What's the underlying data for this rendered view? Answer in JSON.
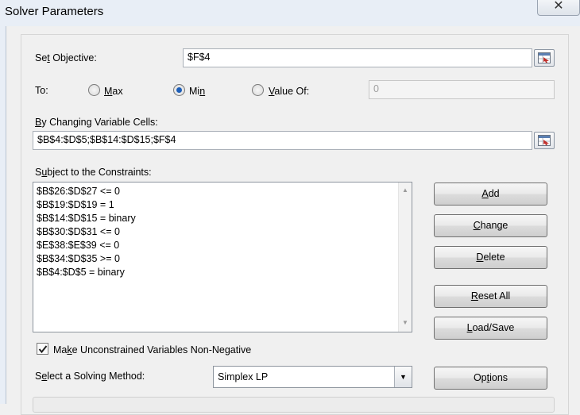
{
  "window": {
    "title": "Solver Parameters",
    "close_glyph": "✕"
  },
  "objective": {
    "set_prefix": "Se",
    "set_key": "t",
    "set_suffix": " Objective:",
    "value": "$F$4"
  },
  "to": {
    "label": "To:",
    "max": {
      "key": "M",
      "rest": "ax",
      "selected": false
    },
    "min": {
      "pre": "Mi",
      "key": "n",
      "selected": true
    },
    "value_of": {
      "key": "V",
      "rest": "alue Of:",
      "selected": false
    },
    "value_of_input": "0"
  },
  "changing": {
    "label_key": "B",
    "label_rest": "y Changing Variable Cells:",
    "value": "$B$4:$D$5;$B$14:$D$15;$F$4"
  },
  "constraints": {
    "label_pre": "S",
    "label_key": "u",
    "label_rest": "bject to the Constraints:",
    "items": [
      "$B$26:$D$27 <= 0",
      "$B$19:$D$19 = 1",
      "$B$14:$D$15 = binary",
      "$B$30:$D$31 <= 0",
      "$E$38:$E$39 <= 0",
      "$B$34:$D$35 >= 0",
      "$B$4:$D$5 = binary"
    ]
  },
  "buttons": {
    "add": {
      "key": "A",
      "rest": "dd"
    },
    "change": {
      "key": "C",
      "rest": "hange"
    },
    "delete": {
      "key": "D",
      "rest": "elete"
    },
    "reset_all": {
      "key": "R",
      "rest": "eset All"
    },
    "load_save": {
      "key": "L",
      "rest": "oad/Save"
    },
    "options": {
      "pre": "Op",
      "key": "t",
      "rest": "ions"
    }
  },
  "nonneg": {
    "checked": true,
    "pre": "Ma",
    "key": "k",
    "rest": "e Unconstrained Variables Non-Negative"
  },
  "method": {
    "label_pre": "S",
    "label_key": "e",
    "label_rest": "lect a Solving Method:",
    "value": "Simplex LP"
  },
  "icons": {
    "ref_button": "range-select-icon",
    "dropdown": "chevron-down-icon",
    "scroll_up": "scroll-up-arrow-icon",
    "scroll_down": "scroll-down-arrow-icon",
    "check": "checkmark-icon"
  },
  "colors": {
    "radio_selected": "#1e5fb8",
    "button_border": "#707070",
    "ref_icon_red": "#c0302c"
  }
}
